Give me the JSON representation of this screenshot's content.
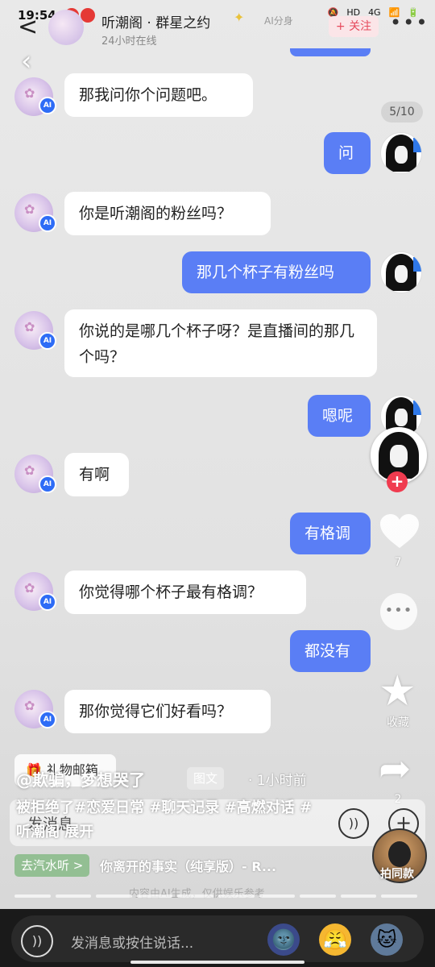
{
  "status_bar": {
    "time": "19:54",
    "network": "4G",
    "hd": "HD"
  },
  "header": {
    "title": "听潮阁 · 群星之约",
    "subtitle": "24小时在线",
    "tag": "AI分身",
    "follow_label": "+ 关注",
    "more_label": "•••",
    "back_label": "<",
    "counter": "5/10"
  },
  "messages": [
    {
      "from": "ai",
      "text": "那我问你个问题吧。"
    },
    {
      "from": "user",
      "text": "问"
    },
    {
      "from": "ai",
      "text": "你是听潮阁的粉丝吗？"
    },
    {
      "from": "user",
      "text": "那几个杯子有粉丝吗"
    },
    {
      "from": "ai",
      "text": "你说的是哪几个杯子呀？是直播间的那几个吗？"
    },
    {
      "from": "user",
      "text": "嗯呢"
    },
    {
      "from": "ai",
      "text": "有啊"
    },
    {
      "from": "user",
      "text": "有格调"
    },
    {
      "from": "ai",
      "text": "你觉得哪个杯子最有格调？"
    },
    {
      "from": "user",
      "text": "都没有"
    },
    {
      "from": "ai",
      "text": "那你觉得它们好看吗？"
    }
  ],
  "ai_badge": "AI",
  "side": {
    "like_count": "7",
    "collect_label": "收藏",
    "share_count": "2",
    "music_label": "拍同款"
  },
  "overlay": {
    "gift_label": "礼物邮箱",
    "composer_placeholder": "发消息",
    "author": "@欺骗，梦想哭了",
    "type_chip": "图文",
    "time_ago": "· 1小时前",
    "caption": "被拒绝了#恋爱日常 #聊天记录 #高燃对话 #听潮阁 展开",
    "music_chip": "去汽水听 >",
    "music_title": "你离开的事实（纯享版）- R...",
    "faint_text": "内容由AI生成，仅供娱乐参考"
  },
  "bottom_bar": {
    "placeholder": "发消息或按住说话..."
  },
  "colors": {
    "accent": "#5a7ef5",
    "follow": "#e64a5c",
    "ai_badge": "#2e6cf6"
  }
}
